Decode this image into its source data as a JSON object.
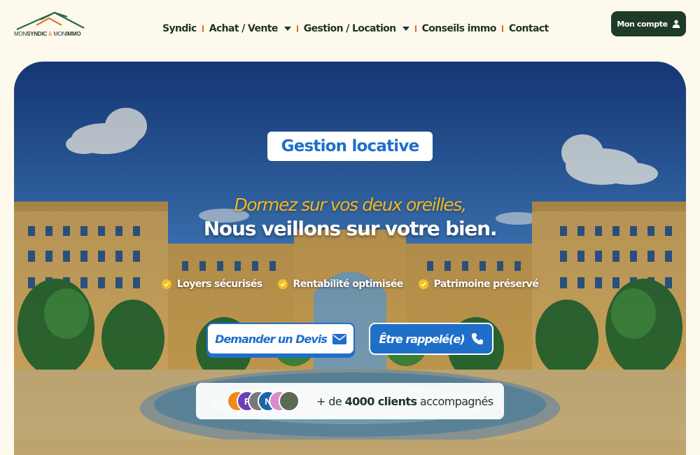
{
  "logo": {
    "part1": "MON",
    "part2": "SYNDIC",
    "amp": "&",
    "part3": "MON",
    "part4": "IMMO"
  },
  "nav": {
    "items": [
      {
        "label": "Syndic"
      },
      {
        "label": "Achat / Vente"
      },
      {
        "label": "Gestion / Location"
      },
      {
        "label": "Conseils immo"
      },
      {
        "label": "Contact"
      }
    ]
  },
  "account": {
    "label": "Mon compte",
    "icon": "user-icon"
  },
  "hero": {
    "badge": "Gestion locative",
    "tagline": "Dormez sur vos deux oreilles,",
    "headline": "Nous veillons sur votre bien.",
    "features": [
      "Loyers sécurisés",
      "Rentabilité optimisée",
      "Patrimoine préservé"
    ],
    "cta_devis": {
      "label": "Demander un Devis",
      "icon": "envelope-icon"
    },
    "cta_rappel": {
      "label": "Être rappelé(e)",
      "icon": "phone-icon"
    },
    "clients": {
      "avatars": [
        {
          "initial": "",
          "color": "#f08a1c"
        },
        {
          "initial": "F",
          "color": "#6a3fb5"
        },
        {
          "initial": "",
          "color": "#7a7a7a"
        },
        {
          "initial": "N",
          "color": "#1e63a8"
        },
        {
          "initial": "",
          "color": "#d98cc9"
        },
        {
          "initial": "",
          "color": "#5b6a55"
        }
      ],
      "prefix": "+ de",
      "count": "4000 clients",
      "suffix": "accompagnés"
    }
  },
  "colors": {
    "brand_dark": "#1f3a26",
    "accent_blue": "#1f6fc9",
    "accent_yellow": "#f5b81c",
    "separator": "#e0662a",
    "background": "#fdf9ec"
  }
}
